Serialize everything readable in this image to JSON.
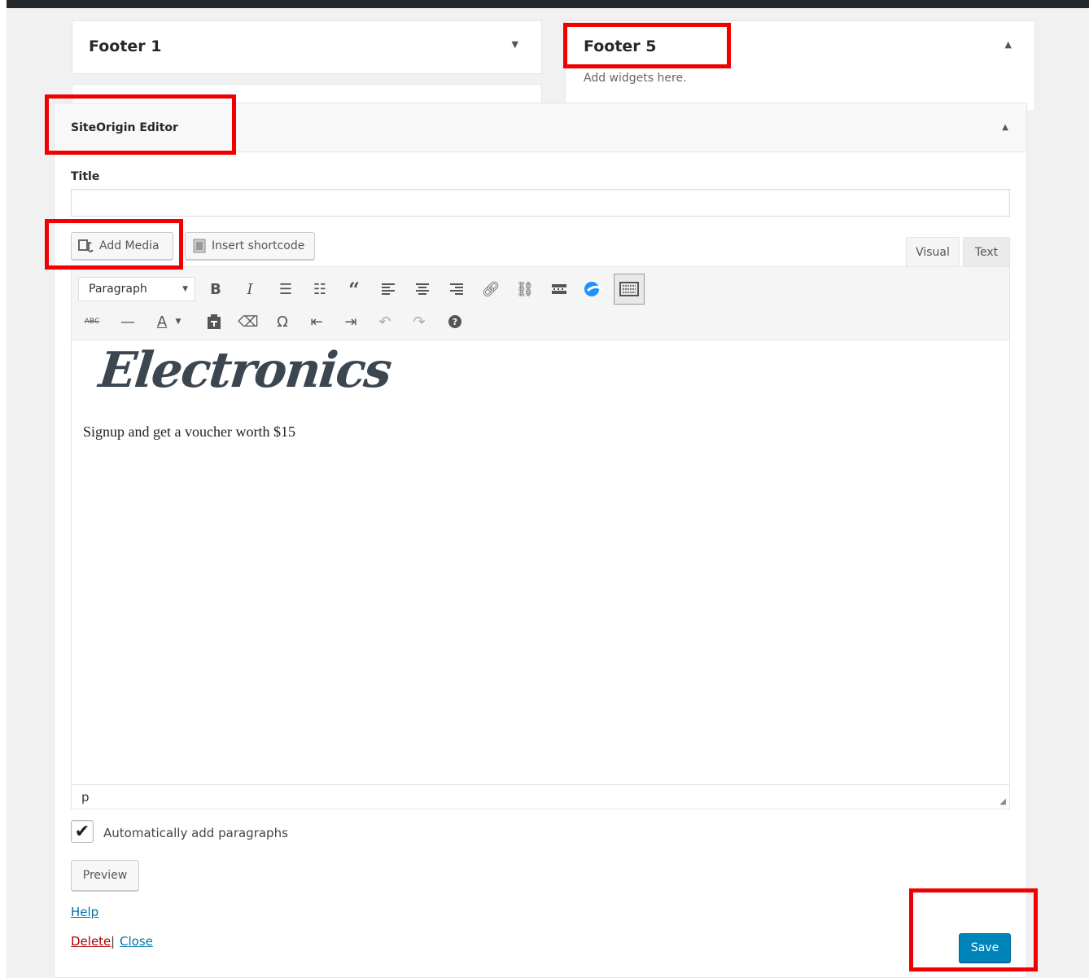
{
  "sidebars": {
    "footer1": {
      "title": "Footer 1"
    },
    "footer5": {
      "title": "Footer 5",
      "hint": "Add widgets here."
    }
  },
  "widget": {
    "title": "SiteOrigin Editor",
    "title_label": "Title",
    "title_value": "",
    "add_media_label": "Add Media",
    "insert_shortcode_label": "Insert shortcode",
    "tabs": {
      "visual": "Visual",
      "text": "Text"
    },
    "format_select": "Paragraph",
    "content": {
      "logo_text": "Electronics",
      "paragraph": "Signup and get a voucher worth $15"
    },
    "status_path": "p",
    "auto_paragraphs_label": "Automatically add paragraphs",
    "auto_paragraphs_checked": true,
    "preview_label": "Preview",
    "help_label": "Help",
    "delete_label": "Delete",
    "separator": "|",
    "close_label": "Close",
    "save_label": "Save"
  },
  "colors": {
    "highlight": "#f00000",
    "primary": "#0085ba",
    "link": "#0073aa",
    "delete": "#aa0000"
  }
}
